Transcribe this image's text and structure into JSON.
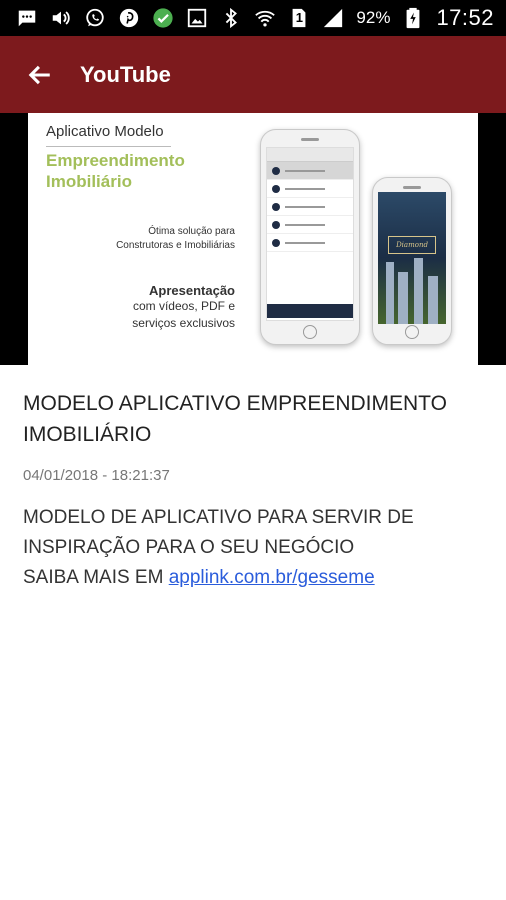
{
  "status_bar": {
    "icons": [
      "message-icon",
      "volume-icon",
      "whatsapp-icon",
      "pinterest-icon",
      "check-icon",
      "image-icon",
      "bluetooth-icon",
      "wifi-icon",
      "sim-icon",
      "signal-icon",
      "battery-icon"
    ],
    "sim_label": "1",
    "battery": "92%",
    "time": "17:52"
  },
  "app_bar": {
    "title": "YouTube",
    "color": "#7d1a1d"
  },
  "thumbnail": {
    "label_model": "Aplicativo Modelo",
    "title_line1": "Empreendimento",
    "title_line2": "Imobiliário",
    "solution_line1": "Ótima solução para",
    "solution_line2": "Construtoras e Imobiliárias",
    "apresentacao": "Apresentação",
    "line1": "com vídeos, PDF e",
    "line2": "serviços exclusivos",
    "phone2_logo": "Diamond"
  },
  "post": {
    "title": "MODELO APLICATIVO EMPREENDIMENTO IMOBILIÁRIO",
    "date": "04/01/2018 - 18:21:37",
    "description_line1": "MODELO DE APLICATIVO PARA SERVIR DE",
    "description_line2": "INSPIRAÇÃO PARA O SEU NEGÓCIO",
    "description_line3_prefix": "SAIBA MAIS EM ",
    "link": "applink.com.br/gesseme"
  }
}
